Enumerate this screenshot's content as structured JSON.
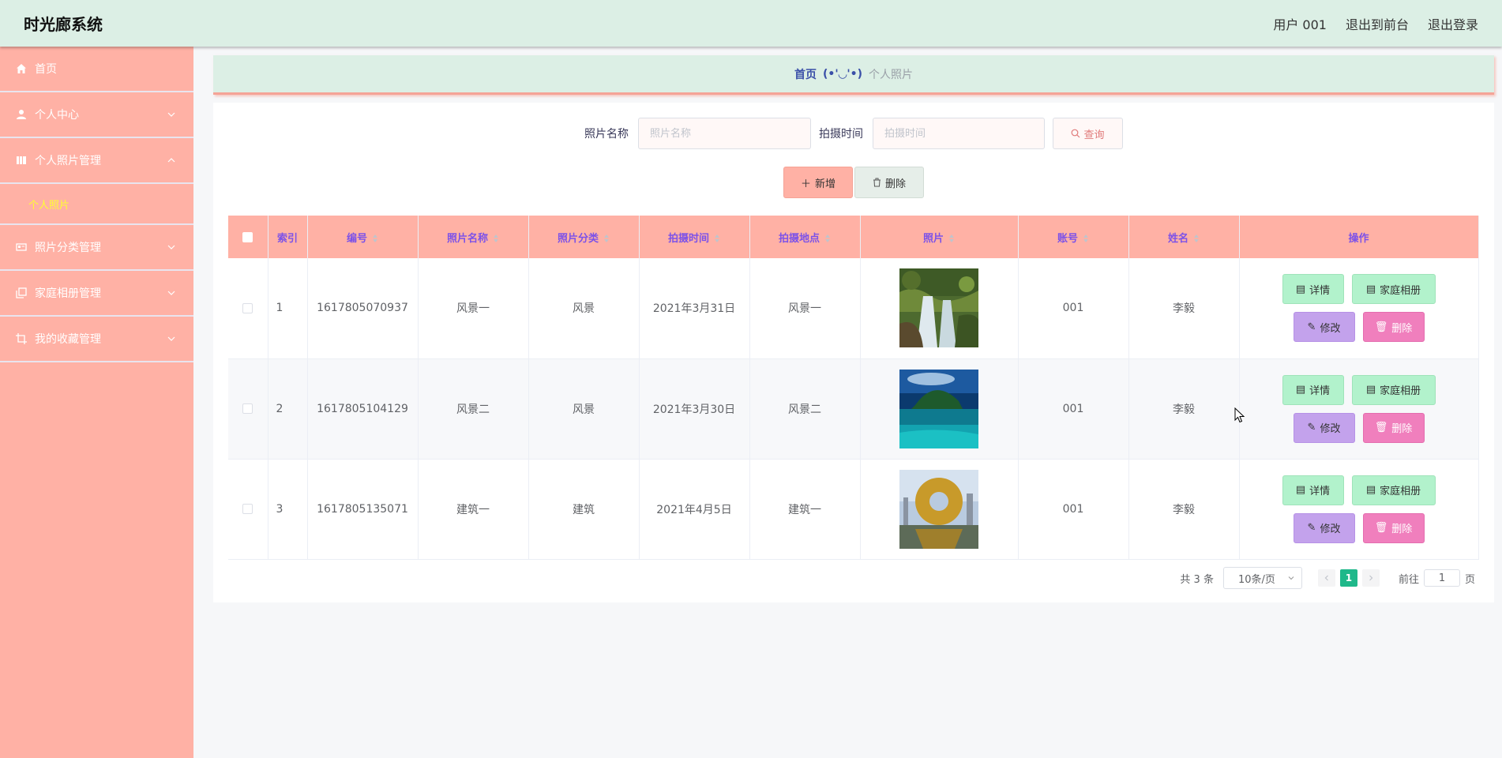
{
  "header": {
    "title": "时光廊系统",
    "user": "用户 001",
    "exit_front": "退出到前台",
    "logout": "退出登录"
  },
  "sidebar": {
    "items": [
      {
        "label": "首页",
        "icon": "home-icon"
      },
      {
        "label": "个人中心",
        "icon": "user-icon"
      },
      {
        "label": "个人照片管理",
        "icon": "photo-book-icon",
        "children": [
          {
            "label": "个人照片"
          }
        ]
      },
      {
        "label": "照片分类管理",
        "icon": "card-icon"
      },
      {
        "label": "家庭相册管理",
        "icon": "copy-icon"
      },
      {
        "label": "我的收藏管理",
        "icon": "crop-icon"
      }
    ]
  },
  "breadcrumb": {
    "home": "首页",
    "separator": "(•'◡'•)",
    "current": "个人照片"
  },
  "search": {
    "name_label": "照片名称",
    "name_placeholder": "照片名称",
    "time_label": "拍摄时间",
    "time_placeholder": "拍摄时间",
    "button": "查询"
  },
  "actions": {
    "add": "新增",
    "delete": "删除"
  },
  "table": {
    "columns": [
      "索引",
      "编号",
      "照片名称",
      "照片分类",
      "拍摄时间",
      "拍摄地点",
      "照片",
      "账号",
      "姓名",
      "操作"
    ],
    "rows": [
      {
        "index": "1",
        "code": "1617805070937",
        "name": "风景一",
        "category": "风景",
        "date": "2021年3月31日",
        "location": "风景一",
        "photo": "waterfall",
        "account": "001",
        "person": "李毅"
      },
      {
        "index": "2",
        "code": "1617805104129",
        "name": "风景二",
        "category": "风景",
        "date": "2021年3月30日",
        "location": "风景二",
        "photo": "island",
        "account": "001",
        "person": "李毅"
      },
      {
        "index": "3",
        "code": "1617805135071",
        "name": "建筑一",
        "category": "建筑",
        "date": "2021年4月5日",
        "location": "建筑一",
        "photo": "ring-building",
        "account": "001",
        "person": "李毅"
      }
    ],
    "ops": {
      "detail": "详情",
      "album": "家庭相册",
      "edit": "修改",
      "remove": "删除"
    }
  },
  "pagination": {
    "total": "共 3 条",
    "page_size": "10条/页",
    "current_page": "1",
    "goto_prefix": "前往",
    "goto_value": "1",
    "goto_suffix": "页"
  },
  "colors": {
    "header_bg": "#dcefe5",
    "sidebar_bg": "#ffb1a5",
    "table_header_bg": "#ffb1a5",
    "header_text": "#7c52e8",
    "detail_btn": "#b2f2cc",
    "edit_btn": "#c3a2ec",
    "remove_btn": "#f07fbd",
    "page_active": "#1fb88a"
  }
}
